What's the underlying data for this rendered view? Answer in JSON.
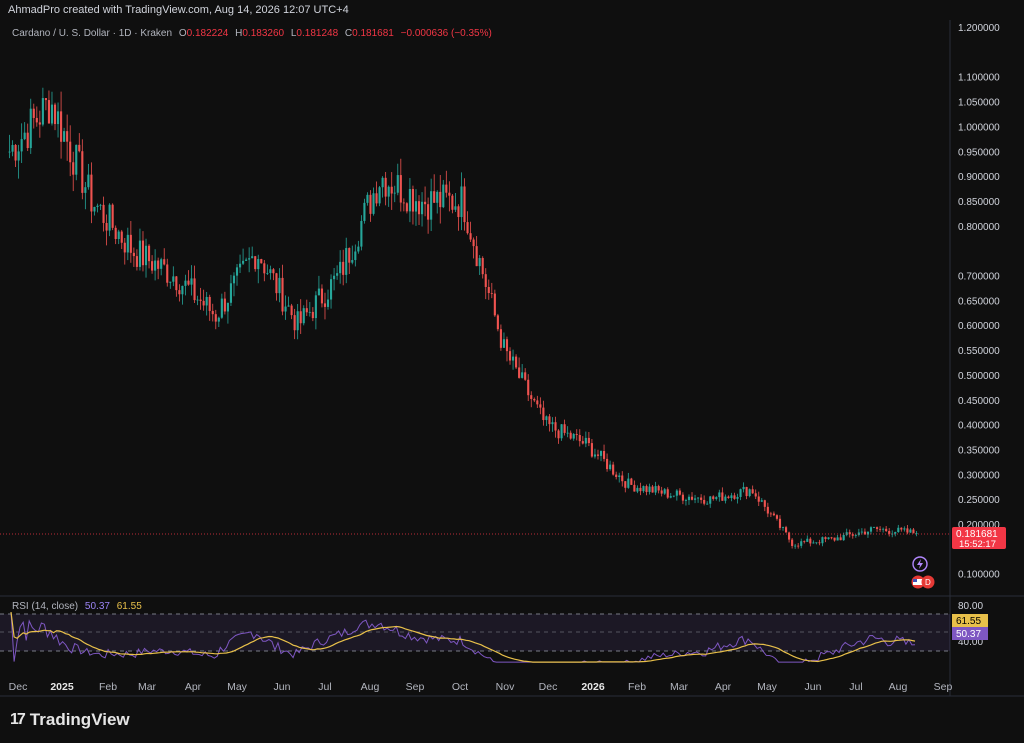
{
  "header": {
    "created_line": "AhmadPro created with TradingView.com, Aug 14, 2026 12:07 UTC+4"
  },
  "legend": {
    "symbol": "Cardano / U. S. Dollar · 1D · Kraken",
    "o_label": "O",
    "o": "0.182224",
    "h_label": "H",
    "h": "0.183260",
    "l_label": "L",
    "l": "0.181248",
    "c_label": "C",
    "c": "0.181681",
    "change": "−0.000636 (−0.35%)"
  },
  "price_badge": {
    "price": "0.181681",
    "countdown": "15:52:17"
  },
  "rsi": {
    "label": "RSI (14, close)",
    "rsi_value": "50.37",
    "ma_value": "61.55",
    "axis_labels": [
      "80.00",
      "40.00"
    ],
    "badge_ma": "61.55",
    "badge_rsi": "50.37"
  },
  "brand": {
    "logo": "17",
    "name": "TradingView"
  },
  "colors": {
    "up": "#26a69a",
    "down": "#ef5350",
    "rsi": "#7e57c2",
    "rsi_ma": "#e8c04a",
    "badge": "#f23645"
  },
  "chart_data": {
    "type": "candlestick",
    "y_axis_labels": [
      "1.200000",
      "1.100000",
      "1.050000",
      "1.000000",
      "0.950000",
      "0.900000",
      "0.850000",
      "0.800000",
      "0.700000",
      "0.650000",
      "0.600000",
      "0.550000",
      "0.500000",
      "0.450000",
      "0.400000",
      "0.350000",
      "0.300000",
      "0.250000",
      "0.200000",
      "0.100000"
    ],
    "x_axis_labels": [
      "Dec",
      "2025",
      "Feb",
      "Mar",
      "Apr",
      "May",
      "Jun",
      "Jul",
      "Aug",
      "Sep",
      "Oct",
      "Nov",
      "Dec",
      "2026",
      "Feb",
      "Mar",
      "Apr",
      "May",
      "Jun",
      "Jul",
      "Aug",
      "Sep"
    ],
    "approx_close_path": [
      {
        "x": "Dec 2024",
        "y": 0.95
      },
      {
        "x": "2025",
        "y": 1.05
      },
      {
        "x": "Jan 2025",
        "y": 0.85
      },
      {
        "x": "Feb 2025",
        "y": 0.75
      },
      {
        "x": "Mar 2025",
        "y": 0.7
      },
      {
        "x": "Apr 2025",
        "y": 0.62
      },
      {
        "x": "May 2025",
        "y": 0.75
      },
      {
        "x": "Jun 2025",
        "y": 0.6
      },
      {
        "x": "Jul 2025",
        "y": 0.7
      },
      {
        "x": "Aug 2025",
        "y": 0.9
      },
      {
        "x": "Sep 2025",
        "y": 0.85
      },
      {
        "x": "Oct 2025",
        "y": 0.85
      },
      {
        "x": "Nov 2025",
        "y": 0.55
      },
      {
        "x": "Dec 2025",
        "y": 0.4
      },
      {
        "x": "2026",
        "y": 0.36
      },
      {
        "x": "Feb 2026",
        "y": 0.28
      },
      {
        "x": "Mar 2026",
        "y": 0.26
      },
      {
        "x": "Apr 2026",
        "y": 0.25
      },
      {
        "x": "May 2026",
        "y": 0.27
      },
      {
        "x": "Jun 2026",
        "y": 0.16
      },
      {
        "x": "Jul 2026",
        "y": 0.17
      },
      {
        "x": "Aug 2026",
        "y": 0.19
      },
      {
        "x": "Aug 14 2026",
        "y": 0.181681
      }
    ],
    "last_close": 0.181681,
    "rsi_scale": [
      40,
      80
    ]
  }
}
